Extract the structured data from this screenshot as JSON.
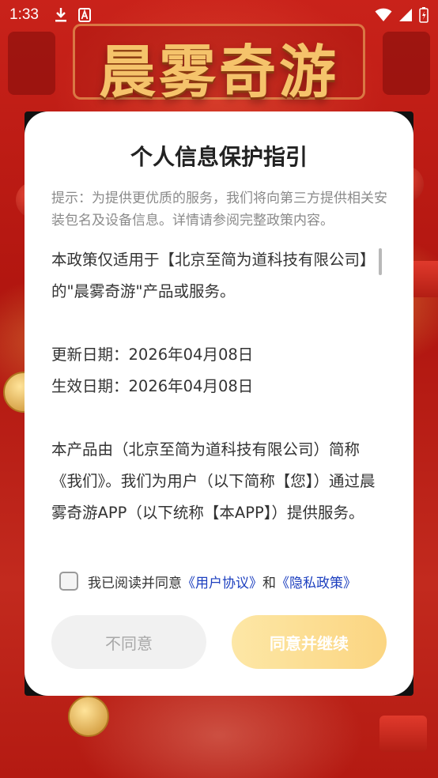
{
  "status_bar": {
    "time": "1:33",
    "left_icons": [
      "download-icon",
      "a-badge-icon"
    ],
    "right_icons": [
      "wifi-icon",
      "signal-icon",
      "battery-icon"
    ]
  },
  "app": {
    "game_title": "晨雾奇游"
  },
  "dialog": {
    "title": "个人信息保护指引",
    "hint": "提示：为提供更优质的服务，我们将向第三方提供相关安装包名及设备信息。详情请参阅完整政策内容。",
    "paragraphs": [
      "本政策仅适用于【北京至简为道科技有限公司】的\"晨雾奇游\"产品或服务。",
      "更新日期：2026年04月08日",
      "生效日期：2026年04月08日",
      "本产品由（北京至简为道科技有限公司）简称《我们》。我们为用户（以下简称【您】）通过晨雾奇游APP（以下统称【本APP】）提供服务。"
    ],
    "agree_prefix": "我已阅读并同意",
    "user_agreement_link": "《用户协议》",
    "and": "和",
    "privacy_policy_link": "《隐私政策》",
    "disagree_button": "不同意",
    "agree_button": "同意并继续",
    "checkbox_checked": false
  },
  "colors": {
    "link": "#1c3fbf",
    "agree_button": "#fbd581",
    "background": "#b51a14"
  }
}
